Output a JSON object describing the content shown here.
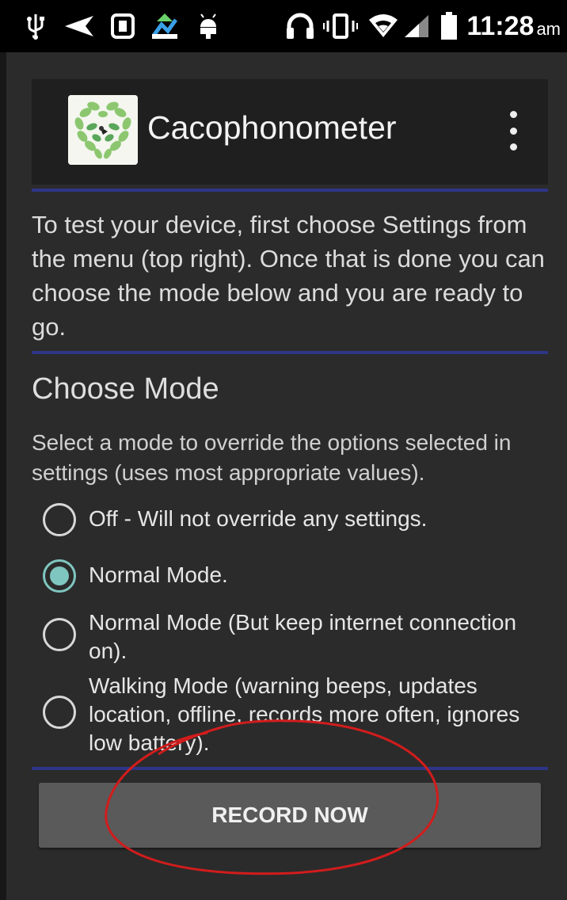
{
  "status_bar": {
    "time": "11:28",
    "ampm": "am",
    "icons": [
      "usb-icon",
      "send-icon",
      "sim-icon",
      "upload-icon",
      "android-icon",
      "headset-icon",
      "vibrate-icon",
      "wifi-icon",
      "signal-icon",
      "battery-icon"
    ]
  },
  "app_bar": {
    "title": "Cacophonometer",
    "menu_icon": "overflow-menu-icon"
  },
  "intro_text": "To test your device, first choose Settings from the menu (top right). Once that is done you can choose the mode below and you are ready to go.",
  "mode_section": {
    "title": "Choose Mode",
    "description": "Select a mode to override the options selected in settings (uses most appropriate values).",
    "options": [
      {
        "label": "Off - Will not override any settings.",
        "checked": false
      },
      {
        "label": "Normal Mode.",
        "checked": true
      },
      {
        "label": "Normal Mode (But keep internet connection on).",
        "checked": false
      },
      {
        "label": "Walking Mode (warning beeps, updates location, offline, records more often, ignores low battery).",
        "checked": false
      }
    ]
  },
  "record_button": {
    "label": "RECORD NOW"
  },
  "colors": {
    "background": "#2b2b2b",
    "app_bar": "#1f1f1f",
    "divider": "#2e3587",
    "radio_accent": "#7fc6c0",
    "button": "#5a5a5a",
    "annotation": "#d21c1c"
  }
}
